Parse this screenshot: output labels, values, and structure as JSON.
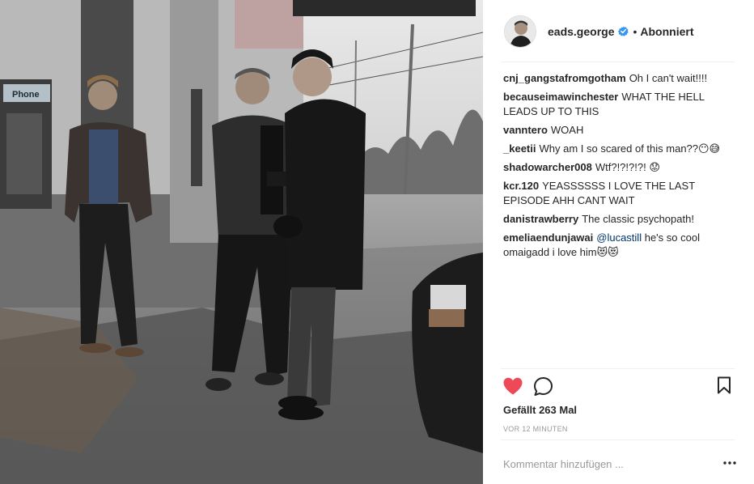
{
  "header": {
    "username": "eads.george",
    "separator": "•",
    "follow_status": "Abonniert"
  },
  "comments": [
    {
      "user": "cnj_gangstafromgotham",
      "text": "Oh I can't wait!!!!"
    },
    {
      "user": "becauseimawinchester",
      "text": "WHAT THE HELL LEADS UP TO THIS"
    },
    {
      "user": "vanntero",
      "text": "WOAH"
    },
    {
      "user": "_keetii",
      "text": "Why am I so scared of this man??😶😅"
    },
    {
      "user": "shadowarcher008",
      "text": "Wtf?!?!?!?! 😟"
    },
    {
      "user": "kcr.120",
      "text": "YEASSSSSS I LOVE THE LAST EPISODE AHH CANT WAIT"
    },
    {
      "user": "danistrawberry",
      "text": "The classic psychopath!"
    },
    {
      "user": "emeliaendunjawai",
      "mention": "@lucastill",
      "text": "he's so cool omaigadd i love him😻😻"
    }
  ],
  "photo": {
    "sign_text": "Phone"
  },
  "actions": {
    "like_icon": "heart-filled-icon",
    "comment_icon": "comment-icon",
    "save_icon": "bookmark-icon",
    "like_color": "#ed4956"
  },
  "likes_text": "Gefällt 263 Mal",
  "timestamp": "VOR 12 MINUTEN",
  "comment_input": {
    "placeholder": "Kommentar hinzufügen ..."
  },
  "more_icon": "more-options-icon"
}
